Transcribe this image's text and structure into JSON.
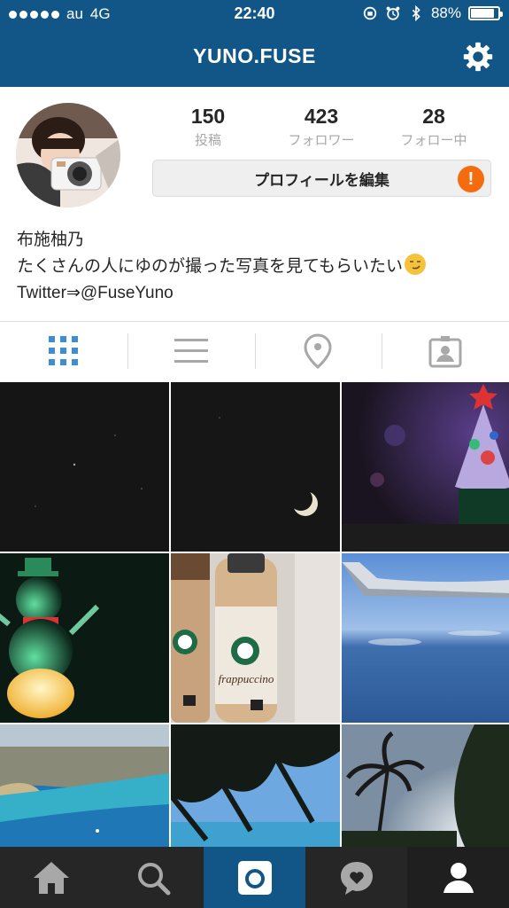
{
  "status_bar": {
    "carrier": "au",
    "network": "4G",
    "time": "22:40",
    "battery_percent": "88%",
    "battery_level": 0.88
  },
  "header": {
    "title": "YUNO.FUSE",
    "settings_icon": "gear-icon",
    "background_color": "#125688"
  },
  "profile": {
    "stats": [
      {
        "count": "150",
        "label": "投稿"
      },
      {
        "count": "423",
        "label": "フォロワー"
      },
      {
        "count": "28",
        "label": "フォロー中"
      }
    ],
    "edit_button_label": "プロフィールを編集",
    "alert_badge": "!",
    "bio": {
      "name": "布施柚乃",
      "line": "たくさんの人にゆのが撮った写真を見てもらいたい",
      "link": "Twitter⇒@FuseYuno"
    }
  },
  "view_tabs": [
    {
      "icon": "grid-icon",
      "active": true
    },
    {
      "icon": "list-icon",
      "active": false
    },
    {
      "icon": "location-pin-icon",
      "active": false
    },
    {
      "icon": "tagged-person-icon",
      "active": false
    }
  ],
  "photos": [
    {
      "subject": "night-sky-stars"
    },
    {
      "subject": "crescent-moon"
    },
    {
      "subject": "christmas-tree-light"
    },
    {
      "subject": "snowman-light"
    },
    {
      "subject": "starbucks-frappuccino-bottles",
      "brand_text": "frappuccino"
    },
    {
      "subject": "airplane-wing-over-sea"
    },
    {
      "subject": "coastal-city-aerial"
    },
    {
      "subject": "palm-leaves-sky"
    },
    {
      "subject": "palm-tree-sunset"
    }
  ],
  "bottom_nav": [
    {
      "icon": "home-icon",
      "active": false
    },
    {
      "icon": "search-icon",
      "active": false
    },
    {
      "icon": "camera-icon",
      "active": true
    },
    {
      "icon": "activity-heart-icon",
      "active": false
    },
    {
      "icon": "profile-icon",
      "active": false
    }
  ],
  "colors": {
    "accent": "#125688",
    "tab_active": "#3f8ed5",
    "alert": "#f56c0f"
  }
}
